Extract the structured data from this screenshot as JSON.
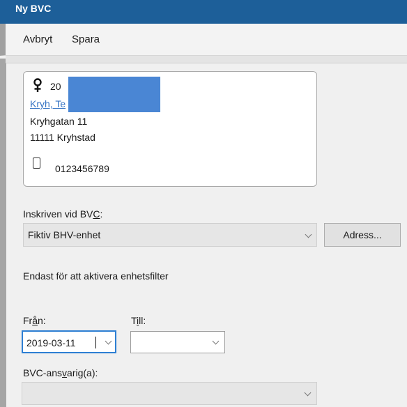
{
  "window": {
    "title": "Ny BVC"
  },
  "menu": {
    "cancel_label": "Avbryt",
    "save_label": "Spara"
  },
  "patient": {
    "id_partial": "20",
    "name_partial": "Kryh, Te",
    "street": "Kryhgatan 11",
    "postal": "11111 Kryhstad",
    "phone": "0123456789"
  },
  "unit": {
    "label": "Inskriven vid BVC:",
    "value": "Fiktiv BHV-enhet",
    "address_button": "Adress..."
  },
  "filter": {
    "note": "Endast för att aktivera enhetsfilter",
    "from_label": "Från:",
    "from_value": "2019-03-11",
    "to_label": "Till:",
    "to_value": ""
  },
  "responsible": {
    "label": "BVC-ansvarig(a):",
    "value": ""
  }
}
